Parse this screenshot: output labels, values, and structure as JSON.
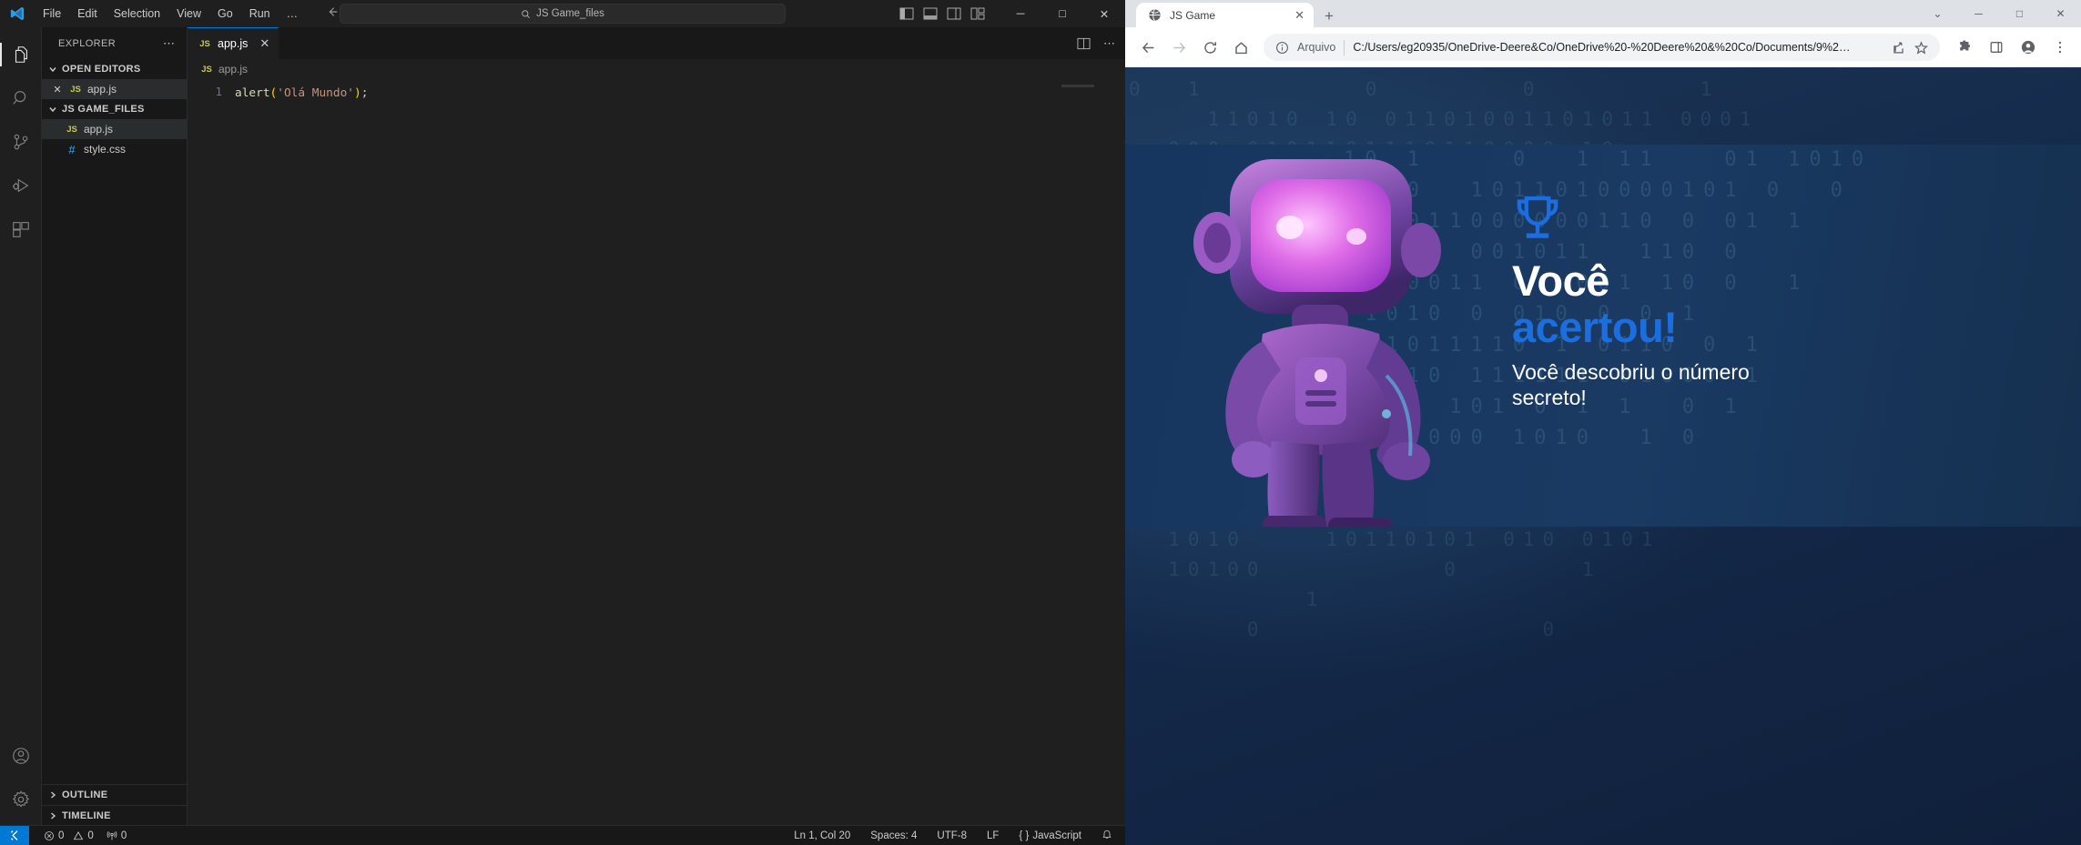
{
  "vscode": {
    "menu": [
      "File",
      "Edit",
      "Selection",
      "View",
      "Go",
      "Run",
      "…"
    ],
    "search_placeholder": "JS Game_files",
    "search_icon": "search-icon",
    "window_controls": {
      "minimize": "─",
      "maximize": "□",
      "close": "✕"
    },
    "activity_bar": [
      {
        "name": "explorer",
        "icon": "files-icon"
      },
      {
        "name": "search",
        "icon": "search-icon"
      },
      {
        "name": "source-control",
        "icon": "source-control-icon"
      },
      {
        "name": "run-and-debug",
        "icon": "run-debug-icon"
      },
      {
        "name": "extensions",
        "icon": "extensions-icon"
      },
      {
        "name": "accounts",
        "icon": "account-icon"
      },
      {
        "name": "manage",
        "icon": "gear-icon"
      }
    ],
    "sidebar": {
      "title": "EXPLORER",
      "more_actions": "⋯",
      "open_editors": {
        "label": "OPEN EDITORS",
        "items": [
          {
            "name": "app.js",
            "icon": "js-icon",
            "close": "✕"
          }
        ]
      },
      "workspace": {
        "label": "JS GAME_FILES",
        "items": [
          {
            "name": "app.js",
            "icon": "js-icon",
            "selected": true
          },
          {
            "name": "style.css",
            "icon": "css-icon",
            "selected": false
          }
        ]
      },
      "outline": "OUTLINE",
      "timeline": "TIMELINE"
    },
    "editor": {
      "tab": {
        "label": "app.js",
        "icon": "js-icon",
        "close": "✕"
      },
      "breadcrumb": {
        "icon": "js-icon",
        "label": "app.js"
      },
      "line_number": "1",
      "code": {
        "fn": "alert",
        "open_paren": "(",
        "string": "'Olá Mundo'",
        "close_paren": ")",
        "semicolon": ";"
      }
    },
    "statusbar": {
      "remote_icon": "remote-window-icon",
      "errors": "0",
      "warnings": "0",
      "ports": "0",
      "cursor": "Ln 1, Col 20",
      "indent": "Spaces: 4",
      "encoding": "UTF-8",
      "eol": "LF",
      "language": "JavaScript",
      "bell_icon": "bell-icon"
    }
  },
  "browser": {
    "tab": {
      "title": "JS Game",
      "favicon": "globe-icon",
      "close": "✕"
    },
    "new_tab": "+",
    "window_controls": {
      "collapse": "⌄",
      "minimize": "─",
      "maximize": "□",
      "close": "✕"
    },
    "toolbar": {
      "back": "back-arrow-icon",
      "forward": "forward-arrow-icon",
      "reload": "reload-icon",
      "home": "home-icon",
      "scheme_label": "Arquivo",
      "url": "C:/Users/eg20935/OneDrive-Deere&Co/OneDrive%20-%20Deere%20&%20Co/Documents/9%2…",
      "share_icon": "share-icon",
      "bookmark_icon": "star-icon",
      "extensions_icon": "puzzle-icon",
      "sidepanel_icon": "side-panel-icon",
      "profile_icon": "profile-icon",
      "menu_icon": "three-dot-menu-icon"
    },
    "page": {
      "trophy_icon": "trophy-icon",
      "heading_line1": "Você",
      "heading_line2": "acertou!",
      "subtitle": "Você descobriu o número secreto!",
      "robot_alt": "astronaut-robot-illustration",
      "colors": {
        "accent": "#1b6ee0",
        "heading": "#ffffff",
        "bg": "#16365f"
      },
      "binary_top": "0  1        0       0        1\n    11010 10 01101001101011 0001\n  000 0101101110110000 10\n      011000010011011 1 0\n  000011 1  101101000010\n 001011100000011 0 0    1\n      1 01  0101      001011\n   11111110              0100011 00\n 1000010111       10011 00 0 1\n 1001101000010 1 1000101 1\n  0110101010100 11 0 0 1\n 10100 1111111 01000  0 11\n 110    001100001110110001 0\n  1000110001 0101   1 0 1\n 0100  11  0 00   110 01101  11011\n  1010    10110101 010 0101\n  10100         0      1\n         1\n      0              0",
      "binary_card": "10 1    0  1 11   01 1010\n 1 0  1011010000101 0  0\n 00011000000110 0 01 1\n   1  001011  110 0\n 110011 0  001 10 0  1\n 1010 0 010 0 0 1\n 11011110 1 0110 0 1\n 0010 111111 01000 1\n  10 101 0 1 1  0 1\n 11 000 1010  1 0"
    }
  }
}
